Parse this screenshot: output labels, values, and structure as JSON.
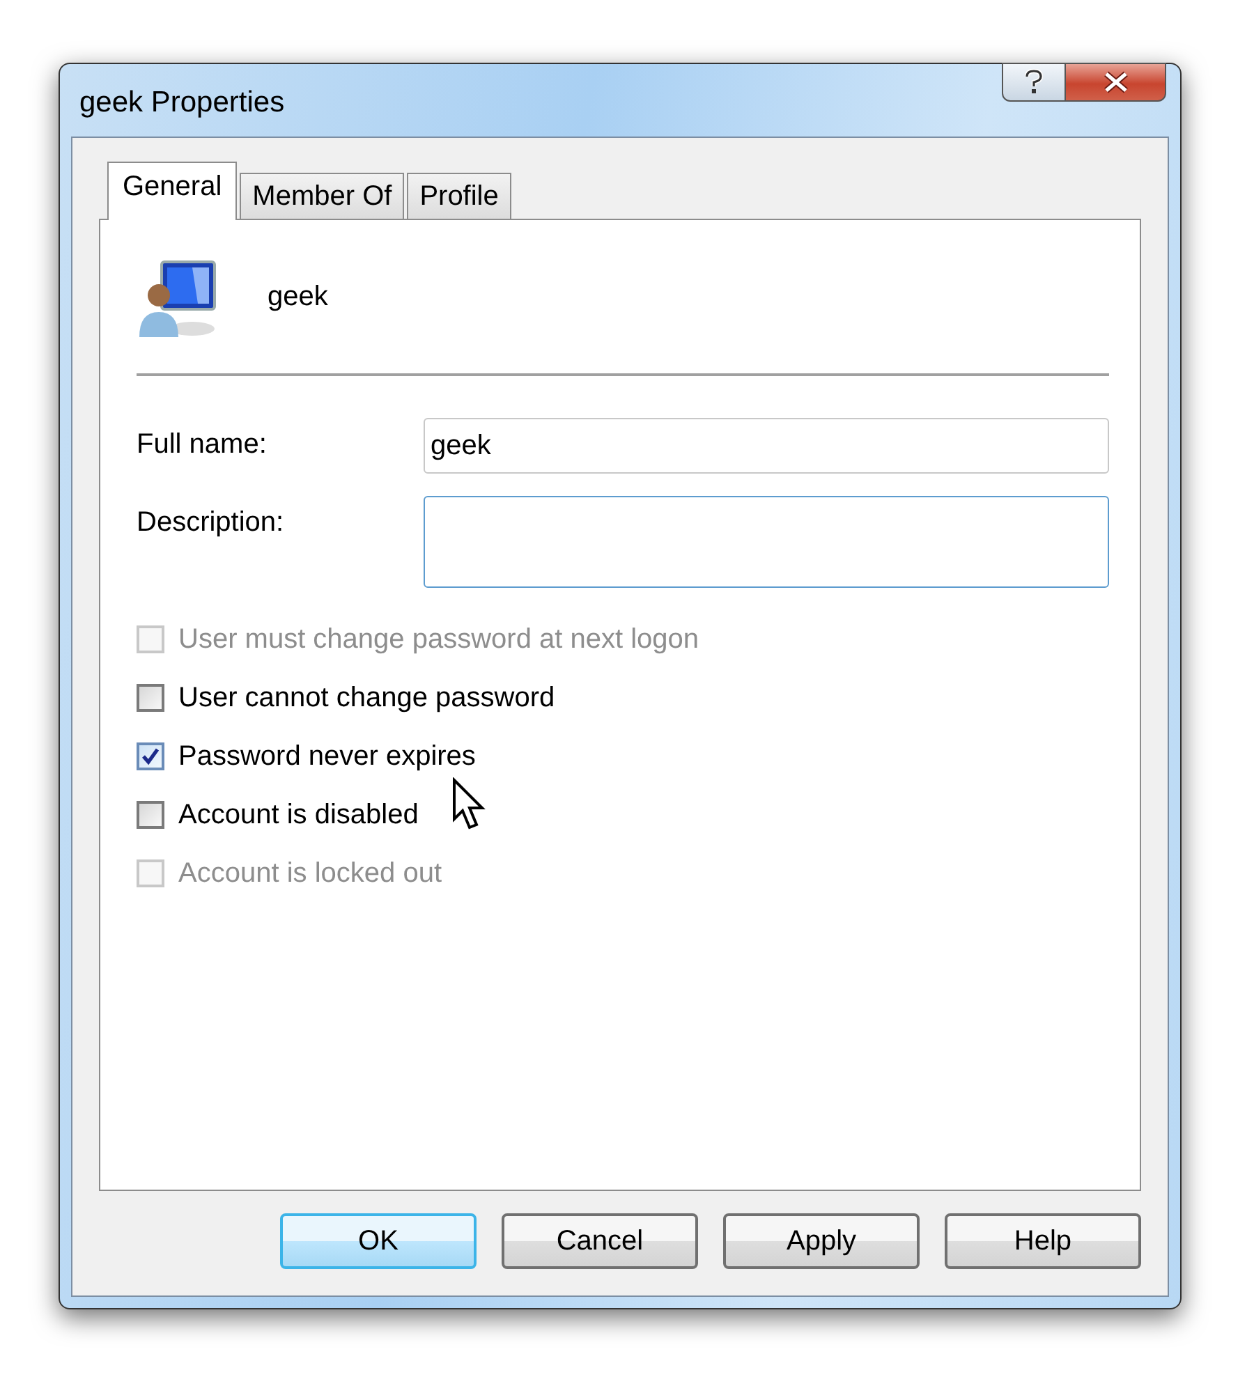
{
  "window": {
    "title": "geek Properties"
  },
  "tabs": [
    {
      "label": "General",
      "selected": true
    },
    {
      "label": "Member Of",
      "selected": false
    },
    {
      "label": "Profile",
      "selected": false
    }
  ],
  "user": {
    "name": "geek"
  },
  "fields": [
    {
      "label": "Full name:",
      "value": "geek",
      "focused": false
    },
    {
      "label": "Description:",
      "focused": true
    }
  ],
  "options": [
    {
      "label": "User must change password at next logon",
      "checked": false,
      "disabled": true
    },
    {
      "label": "User cannot change password",
      "checked": false,
      "disabled": false
    },
    {
      "label": "Password never expires",
      "checked": true,
      "disabled": false
    },
    {
      "label": "Account is disabled",
      "checked": false,
      "disabled": false
    },
    {
      "label": "Account is locked out",
      "checked": false,
      "disabled": true
    }
  ],
  "buttons": [
    {
      "label": "OK",
      "default": true
    },
    {
      "label": "Cancel",
      "default": false
    },
    {
      "label": "Apply",
      "default": false
    },
    {
      "label": "Help",
      "default": false
    }
  ]
}
